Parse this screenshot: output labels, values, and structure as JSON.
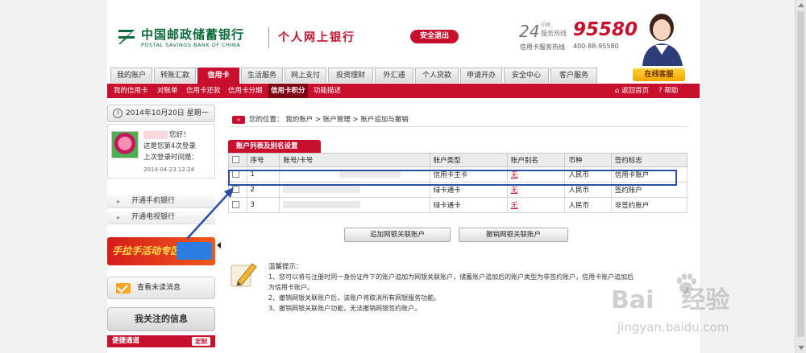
{
  "header": {
    "bank_name_cn": "中国邮政储蓄银行",
    "bank_name_en": "POSTAL SAVINGS BANK OF CHINA",
    "bank_title": "个人网上银行",
    "logout": "安全退出",
    "hotline_24": "24",
    "hotline_hours": "小时",
    "hotline_label": "服务热线",
    "hotline_num": "95580",
    "card_hotline_label": "信用卡服务热线",
    "card_hotline_num": "400-88-95580"
  },
  "nav": {
    "tabs": [
      "我的账户",
      "转账汇款",
      "信用卡",
      "生活服务",
      "网上支付",
      "投资理财",
      "外汇通",
      "个人贷款",
      "申请开办",
      "安全中心",
      "客户服务"
    ],
    "active": "信用卡",
    "service_btn": "在线客服"
  },
  "subnav": {
    "items": [
      "我的信用卡",
      "对账单",
      "信用卡还款",
      "信用卡分期",
      "信用卡积分",
      "功能描述"
    ],
    "active": "信用卡积分",
    "back_home": "返回首页",
    "help": "帮助"
  },
  "sidebar": {
    "date": "2014年10月20日 星期一",
    "greeting": "您好！",
    "login_count": "这是您第4次登录",
    "last_login_label": "上次登录时间是：",
    "last_login_time": "2014-04-23 12:24",
    "links": [
      "开通手机银行",
      "开通电视银行"
    ],
    "promo": "手拉手活动专区",
    "unread": "查看未读消息",
    "focus": "我关注的信息",
    "quick": "便捷通道",
    "custom": "定制"
  },
  "main": {
    "breadcrumb": "您的位置： 我的账户 > 账户管理 > 账户追加与撤销",
    "section_tab": "账户列表及别名设置",
    "columns": [
      "",
      "序号",
      "账号/卡号",
      "账户类型",
      "账户别名",
      "币种",
      "签约标志"
    ],
    "rows": [
      {
        "no": "1",
        "type": "信用卡主卡",
        "alias": "无",
        "currency": "人民币",
        "flag": "信用卡账户"
      },
      {
        "no": "2",
        "type": "绿卡通卡",
        "alias": "无",
        "currency": "人民币",
        "flag": "签约账户"
      },
      {
        "no": "3",
        "type": "绿卡通卡",
        "alias": "无",
        "currency": "人民币",
        "flag": "非签约账户"
      }
    ],
    "btn_add": "追加网银关联账户",
    "btn_remove": "撤销网银关联账户",
    "tips_title": "温馨提示：",
    "tips": [
      "1、您可以将与注册时同一身份证件下的账户追加为网银关联账户，储蓄账户追加后的账户类型为非签约账户，信用卡账户追加后",
      "为信用卡账户。",
      "2、撤销网银关联账户后，该账户将取消所有网银服务功能。",
      "3、撤销网银关联账户功能，无法撤销网银签约账户。"
    ]
  },
  "watermark": {
    "logo": "Bai",
    "logo2": "经验",
    "url": "jingyan.baidu.com"
  },
  "colors": {
    "brand_red": "#c8102e",
    "brand_green": "#0b6b3a",
    "highlight_blue": "#2b4fa8"
  }
}
